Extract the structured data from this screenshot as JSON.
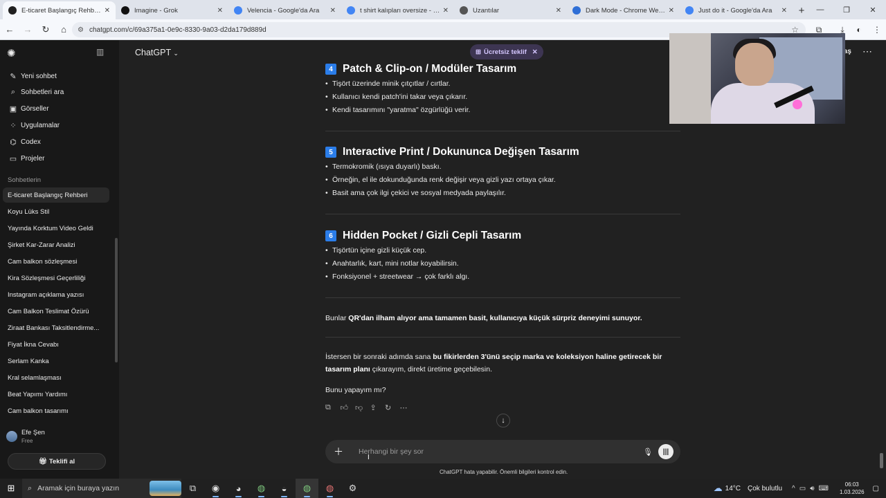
{
  "browser": {
    "tabs": [
      {
        "title": "E-ticaret Başlangıç Rehberi",
        "favicon": "chatgpt-icon",
        "color": "#202020",
        "active": true
      },
      {
        "title": "Imagine - Grok",
        "favicon": "grok-icon",
        "color": "#111111",
        "active": false
      },
      {
        "title": "Velencia - Google'da Ara",
        "favicon": "google-icon",
        "color": "#4285f4",
        "active": false
      },
      {
        "title": "t shirt kalıpları oversize - Goog",
        "favicon": "google-icon",
        "color": "#4285f4",
        "active": false
      },
      {
        "title": "Uzantılar",
        "favicon": "puzzle-icon",
        "color": "#555555",
        "active": false
      },
      {
        "title": "Dark Mode - Chrome Web Mağ",
        "favicon": "webstore-icon",
        "color": "#2f6fd6",
        "active": false
      },
      {
        "title": "Just do it - Google'da Ara",
        "favicon": "google-icon",
        "color": "#4285f4",
        "active": false
      }
    ],
    "url": "chatgpt.com/c/69a375a1-0e9c-8330-9a03-d2da179d889d"
  },
  "sidebar": {
    "nav": [
      {
        "label": "Yeni sohbet",
        "icon": "edit-icon"
      },
      {
        "label": "Sohbetleri ara",
        "icon": "search-icon"
      },
      {
        "label": "Görseller",
        "icon": "images-icon"
      },
      {
        "label": "Uygulamalar",
        "icon": "apps-icon"
      },
      {
        "label": "Codex",
        "icon": "codex-icon"
      },
      {
        "label": "Projeler",
        "icon": "folder-icon"
      }
    ],
    "section_label": "Sohbetlerin",
    "chats": [
      "E-ticaret Başlangıç Rehberi",
      "Koyu Lüks Stil",
      "Yayında Korktum Video Geldi",
      "Şirket Kar-Zarar Analizi",
      "Cam balkon sözleşmesi",
      "Kira Sözleşmesi Geçerliliği",
      "Instagram açıklama yazısı",
      "Cam Balkon Teslimat Özürü",
      "Ziraat Bankası Taksitlendirme...",
      "Fiyat İkna Cevabı",
      "Serlam Kanka",
      "Kral selamlaşması",
      "Beat Yapımı Yardımı",
      "Cam balkon tasarımı"
    ],
    "user": {
      "name": "Efe Şen",
      "plan": "Free"
    },
    "upgrade_label": "Teklifi al"
  },
  "header": {
    "model": "ChatGPT",
    "promo": "Ücretsiz teklif",
    "share": "laş"
  },
  "content": {
    "sections": [
      {
        "num": "4",
        "title": "Patch & Clip-on / Modüler Tasarım",
        "bullets": [
          "Tişört üzerinde minik çıtçıtlar / cırtlar.",
          "Kullanıcı kendi patch'ini takar veya çıkarır.",
          "Kendi tasarımını \"yaratma\" özgürlüğü verir."
        ]
      },
      {
        "num": "5",
        "title": "Interactive Print / Dokununca Değişen Tasarım",
        "bullets": [
          "Termokromik (ısıya duyarlı) baskı.",
          "Örneğin, el ile dokunduğunda renk değişir veya gizli yazı ortaya çıkar.",
          "Basit ama çok ilgi çekici ve sosyal medyada paylaşılır."
        ]
      },
      {
        "num": "6",
        "title": "Hidden Pocket / Gizli Cepli Tasarım",
        "bullets": [
          "Tişörtün içine gizli küçük cep.",
          "Anahtarlık, kart, mini notlar koyabilirsin.",
          "Fonksiyonel + streetwear → çok farklı algı."
        ]
      }
    ],
    "summary_prefix": "Bunlar ",
    "summary_bold": "QR'dan ilham alıyor ama tamamen basit, kullanıcıya küçük sürpriz deneyimi sunuyor.",
    "offer_prefix": "İstersen bir sonraki adımda sana ",
    "offer_bold": "bu fikirlerden 3'ünü seçip marka ve koleksiyon haline getirecek bir tasarım planı",
    "offer_suffix": " çıkarayım, direkt üretime geçebilesin.",
    "question": "Bunu yapayım mı?"
  },
  "composer": {
    "placeholder": "Herhangi bir şey sor",
    "disclaimer": "ChatGPT hata yapabilir. Önemli bilgileri kontrol edin."
  },
  "taskbar": {
    "search": "Aramak için buraya yazın",
    "temperature": "14°C",
    "weather": "Çok bulutlu",
    "time": "06:03",
    "date": "1.03.2026"
  }
}
